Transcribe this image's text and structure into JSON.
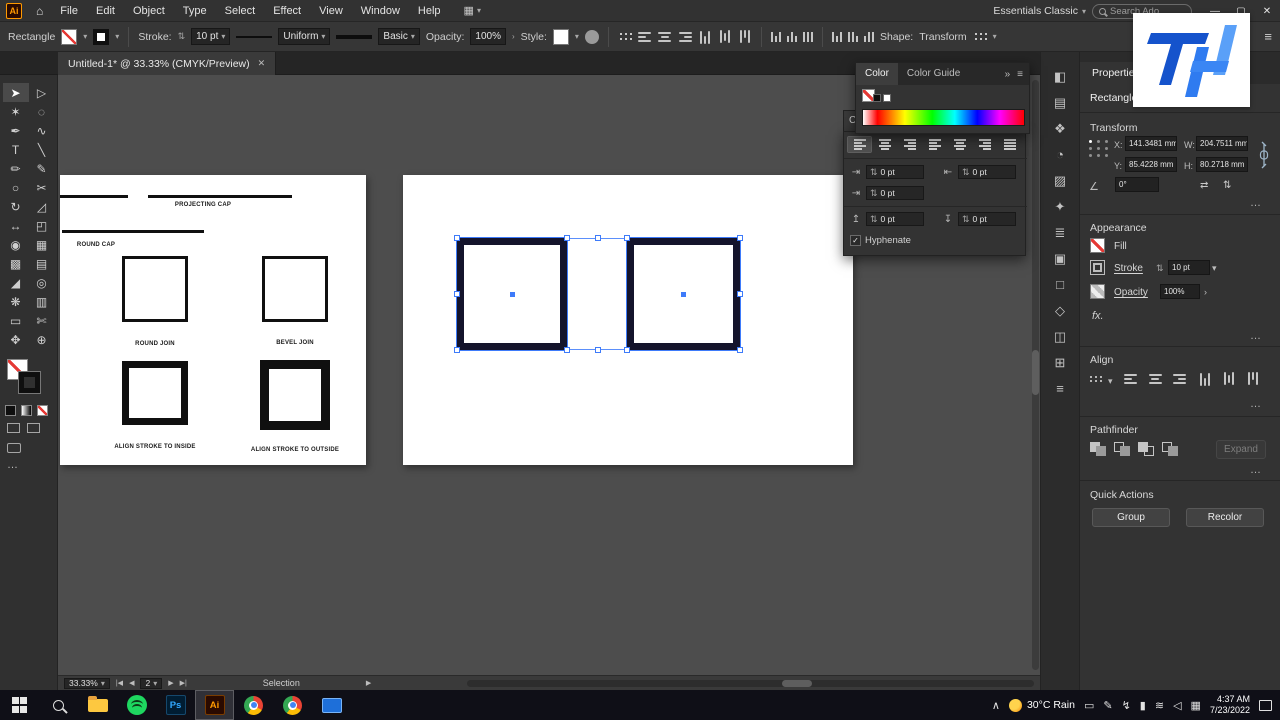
{
  "colors": {
    "selection_blue": "#3e7bfa",
    "ai_orange": "#ff9a00",
    "square_stroke": "#14142c",
    "artboard_white": "#ffffff"
  },
  "icons": {
    "ai_badge": "Ai",
    "home": "⌂",
    "chevron_down": "▾",
    "chevron_right": "›",
    "double_right": "»",
    "stepper": "⇅",
    "menu": "≡",
    "close": "✕",
    "minimize": "—",
    "maximize": "▢",
    "ellipsis": "…",
    "angle": "∠",
    "check": "✓",
    "flip_h": "⇄",
    "flip_v": "⇅",
    "nav_first": "|◀",
    "nav_prev": "◀",
    "nav_next": "▶",
    "nav_last": "▶|",
    "play": "▶",
    "arrange_grid": "▦",
    "tray_chevron": "∧",
    "indent_left": "⇥",
    "indent_right": "⇤",
    "indent_first": "⇥",
    "space_before": "↥",
    "space_after": "↧"
  },
  "menubar": {
    "menus": [
      "File",
      "Edit",
      "Object",
      "Type",
      "Select",
      "Effect",
      "View",
      "Window",
      "Help"
    ],
    "workspace": "Essentials Classic",
    "search": "Search Ado"
  },
  "control_bar": {
    "tool": "Rectangle",
    "stroke_label": "Stroke:",
    "stroke_value": "10 pt",
    "profile": "Uniform",
    "brush": "Basic",
    "opacity_label": "Opacity:",
    "opacity_value": "100%",
    "style_label": "Style:",
    "shape_label": "Shape:",
    "transform_label": "Transform"
  },
  "document_tab": {
    "title": "Untitled-1* @ 33.33% (CMYK/Preview)"
  },
  "tools": {
    "glyphs": [
      "➤",
      "▷",
      "✶",
      "◌",
      "✒",
      "∿",
      "T",
      "╲",
      "✏",
      "✎",
      "○",
      "✂",
      "↻",
      "◿",
      "↔",
      "◰",
      "◉",
      "▦",
      "▩",
      "▤",
      "◢",
      "◎",
      "❋",
      "▥",
      "▭",
      "✄",
      "✥",
      "⊕"
    ]
  },
  "artboard1": {
    "projecting_cap": "PROJECTING CAP",
    "round_cap": "ROUND CAP",
    "round_join": "ROUND JOIN",
    "bevel_join": "BEVEL JOIN",
    "align_inside": "ALIGN STROKE TO INSIDE",
    "align_outside": "ALIGN STROKE TO OUTSIDE"
  },
  "color_panel": {
    "tab_color": "Color",
    "tab_color_guide": "Color Guide"
  },
  "character_panel": {
    "tab": "Ch"
  },
  "paragraph_panel": {
    "left_indent": "0 pt",
    "right_indent": "0 pt",
    "first_line_indent": "0 pt",
    "space_before": "0 pt",
    "space_after": "0 pt",
    "hyphenate": "Hyphenate"
  },
  "dock": {
    "glyphs": [
      "◧",
      "▤",
      "❖",
      "◔",
      "▨",
      "✦",
      "≣",
      "▣",
      "□",
      "◇",
      "◫",
      "⊞",
      "≡"
    ]
  },
  "properties": {
    "tab": "Properties",
    "object": "Rectangle",
    "transform": {
      "title": "Transform",
      "x_label": "X:",
      "x": "141.3481 mm",
      "w_label": "W:",
      "w": "204.7511 mm",
      "y_label": "Y:",
      "y": "85.4228 mm",
      "h_label": "H:",
      "h": "80.2718 mm",
      "angle": "0°"
    },
    "appearance": {
      "title": "Appearance",
      "fill": "Fill",
      "stroke": "Stroke",
      "stroke_value": "10 pt",
      "opacity": "Opacity",
      "opacity_value": "100%",
      "fx": "fx."
    },
    "align_title": "Align",
    "pathfinder": {
      "title": "Pathfinder",
      "expand": "Expand"
    },
    "quick": {
      "title": "Quick Actions",
      "group": "Group",
      "recolor": "Recolor"
    }
  },
  "status_bar": {
    "zoom": "33.33%",
    "artboard_number": "2",
    "status": "Selection"
  },
  "taskbar": {
    "ps": "Ps",
    "ai": "Ai",
    "weather": "30°C Rain",
    "time": "4:37 AM",
    "date": "7/23/2022",
    "tray_glyphs": [
      "▭",
      "✎",
      "↯",
      "▮",
      "≋",
      "◁",
      "▦"
    ]
  }
}
